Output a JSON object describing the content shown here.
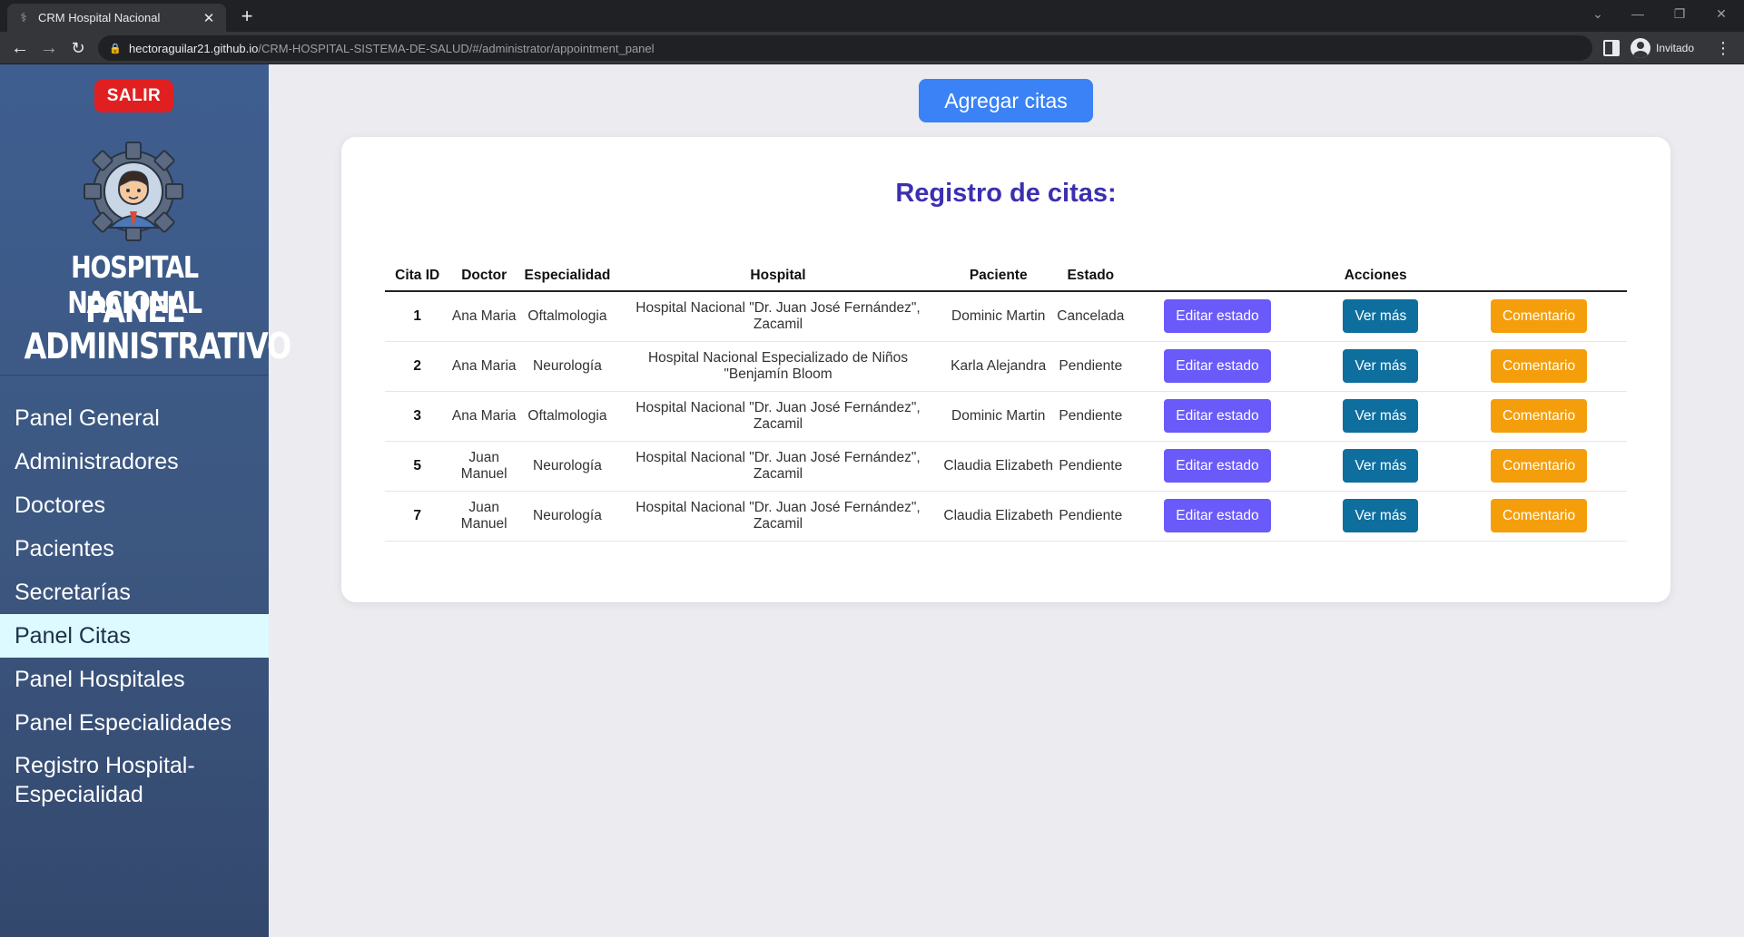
{
  "browser": {
    "tab_title": "CRM Hospital Nacional",
    "url_host": "hectoraguilar21.github.io",
    "url_path": "/CRM-HOSPITAL-SISTEMA-DE-SALUD/#/administrator/appointment_panel",
    "profile_label": "Invitado"
  },
  "sidebar": {
    "logout_label": "SALIR",
    "brand_title": "HOSPITAL NACIONAL",
    "brand_subtitle_line1": "PANEL",
    "brand_subtitle_line2": "ADMINISTRATIVO",
    "items": [
      {
        "label": "Panel General",
        "active": false
      },
      {
        "label": "Administradores",
        "active": false
      },
      {
        "label": "Doctores",
        "active": false
      },
      {
        "label": "Pacientes",
        "active": false
      },
      {
        "label": "Secretarías",
        "active": false
      },
      {
        "label": "Panel Citas",
        "active": true
      },
      {
        "label": "Panel Hospitales",
        "active": false
      },
      {
        "label": "Panel Especialidades",
        "active": false
      },
      {
        "label": "Registro Hospital-Especialidad",
        "active": false
      }
    ]
  },
  "main": {
    "add_button_label": "Agregar citas",
    "card_title": "Registro de citas:",
    "columns": [
      "Cita ID",
      "Doctor",
      "Especialidad",
      "Hospital",
      "Paciente",
      "Estado",
      "Acciones"
    ],
    "action_labels": {
      "edit": "Editar estado",
      "view": "Ver más",
      "comment": "Comentario"
    },
    "rows": [
      {
        "id": "1",
        "doctor": "Ana Maria",
        "especialidad": "Oftalmologia",
        "hospital": "Hospital Nacional \"Dr. Juan José Fernández\", Zacamil",
        "paciente": "Dominic Martin",
        "estado": "Cancelada"
      },
      {
        "id": "2",
        "doctor": "Ana Maria",
        "especialidad": "Neurología",
        "hospital": "Hospital Nacional Especializado de Niños \"Benjamín Bloom",
        "paciente": "Karla Alejandra",
        "estado": "Pendiente"
      },
      {
        "id": "3",
        "doctor": "Ana Maria",
        "especialidad": "Oftalmologia",
        "hospital": "Hospital Nacional \"Dr. Juan José Fernández\", Zacamil",
        "paciente": "Dominic Martin",
        "estado": "Pendiente"
      },
      {
        "id": "5",
        "doctor": "Juan Manuel",
        "especialidad": "Neurología",
        "hospital": "Hospital Nacional \"Dr. Juan José Fernández\", Zacamil",
        "paciente": "Claudia Elizabeth",
        "estado": "Pendiente"
      },
      {
        "id": "7",
        "doctor": "Juan Manuel",
        "especialidad": "Neurología",
        "hospital": "Hospital Nacional \"Dr. Juan José Fernández\", Zacamil",
        "paciente": "Claudia Elizabeth",
        "estado": "Pendiente"
      }
    ]
  },
  "colors": {
    "sidebar": "#3e5e90",
    "active_nav": "#dcfaff",
    "logout": "#e02020",
    "primary": "#3b82f6",
    "title": "#3c2fb0",
    "edit_button": "#6a5af9",
    "view_button": "#0e6e9e",
    "comment_button": "#f59e0b"
  }
}
